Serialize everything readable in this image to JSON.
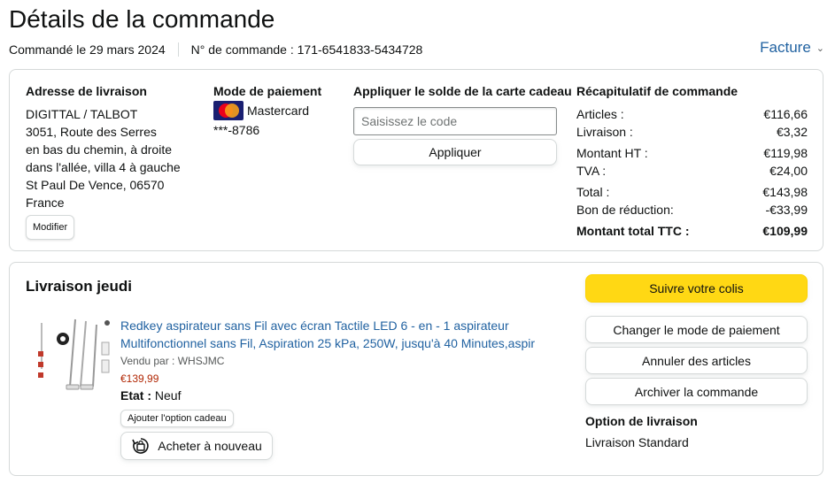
{
  "header": {
    "title": "Détails de la commande",
    "ordered_on": "Commandé le 29 mars 2024",
    "order_number": "N° de commande : 171-6541833-5434728",
    "invoice_label": "Facture"
  },
  "shipping": {
    "heading": "Adresse de livraison",
    "lines": [
      "DIGITTAL / TALBOT",
      "3051, Route des Serres",
      "en bas du chemin, à droite",
      "dans l'allée, villa 4 à gauche",
      "St Paul De Vence, 06570",
      "France"
    ],
    "modify_label": "Modifier"
  },
  "payment": {
    "heading": "Mode de paiement",
    "card_name": "Mastercard",
    "card_number": "***-8786",
    "logo_text": "MasterCard"
  },
  "gift_card": {
    "heading": "Appliquer le solde de la carte cadeau",
    "placeholder": "Saisissez le code",
    "apply_label": "Appliquer"
  },
  "summary": {
    "heading": "Récapitulatif de commande",
    "rows": [
      {
        "label": "Articles :",
        "value": "€116,66"
      },
      {
        "label": "Livraison :",
        "value": "€3,32"
      },
      {
        "label": "Montant HT :",
        "value": "€119,98"
      },
      {
        "label": "TVA :",
        "value": "€24,00"
      },
      {
        "label": "Total :",
        "value": "€143,98"
      },
      {
        "label": "Bon de réduction:",
        "value": "-€33,99"
      },
      {
        "label": "Montant total TTC :",
        "value": "€109,99"
      }
    ]
  },
  "delivery": {
    "heading": "Livraison jeudi",
    "product_title": "Redkey aspirateur sans Fil avec écran Tactile LED 6 - en - 1 aspirateur Multifonctionnel sans Fil, Aspiration 25 kPa, 250W, jusqu'à 40 Minutes,aspir",
    "seller": "Vendu par : WHSJMC",
    "price": "€139,99",
    "condition_label": "Etat :",
    "condition_value": "Neuf",
    "gift_option_label": "Ajouter l'option cadeau",
    "buy_again_label": "Acheter à nouveau",
    "track_label": "Suivre votre colis",
    "change_payment_label": "Changer le mode de paiement",
    "cancel_label": "Annuler des articles",
    "archive_label": "Archiver la commande",
    "option_heading": "Option de livraison",
    "option_value": "Livraison Standard"
  },
  "colors": {
    "link": "#2162a1",
    "price": "#b12704",
    "track_button": "#ffd814",
    "border": "#d5d9d9"
  }
}
